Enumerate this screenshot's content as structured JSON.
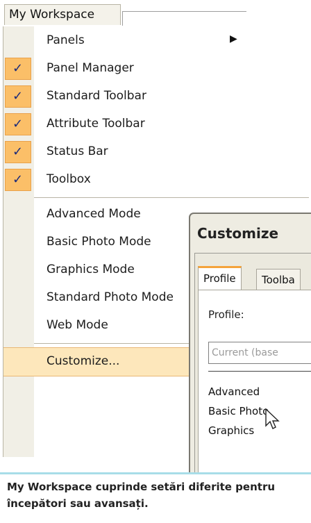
{
  "menubar": {
    "title": "My Workspace"
  },
  "menu": {
    "items": [
      {
        "label": "Panels",
        "checked": false,
        "submenu": true
      },
      {
        "label": "Panel Manager",
        "checked": true
      },
      {
        "label": "Standard Toolbar",
        "checked": true
      },
      {
        "label": "Attribute Toolbar",
        "checked": true
      },
      {
        "label": "Status Bar",
        "checked": true
      },
      {
        "label": "Toolbox",
        "checked": true
      },
      {
        "label": "Advanced Mode",
        "checked": false
      },
      {
        "label": "Basic Photo Mode",
        "checked": false
      },
      {
        "label": "Graphics Mode",
        "checked": false
      },
      {
        "label": "Standard Photo Mode",
        "checked": false
      },
      {
        "label": "Web Mode",
        "checked": false
      },
      {
        "label": "Customize...",
        "checked": false,
        "highlighted": true
      }
    ]
  },
  "dialog": {
    "title": "Customize",
    "tabs": [
      "Profile",
      "Toolba"
    ],
    "profile_label": "Profile:",
    "profile_value": "Current (base",
    "profiles": [
      "Advanced",
      "Basic Photo",
      "Graphics"
    ]
  },
  "caption": "My Workspace cuprinde setări diferite pentru începători sau avansați.",
  "colors": {
    "check_bg": "#fbbf68",
    "highlight_bg": "#fde7bb",
    "caption_border": "#a8dde8"
  }
}
